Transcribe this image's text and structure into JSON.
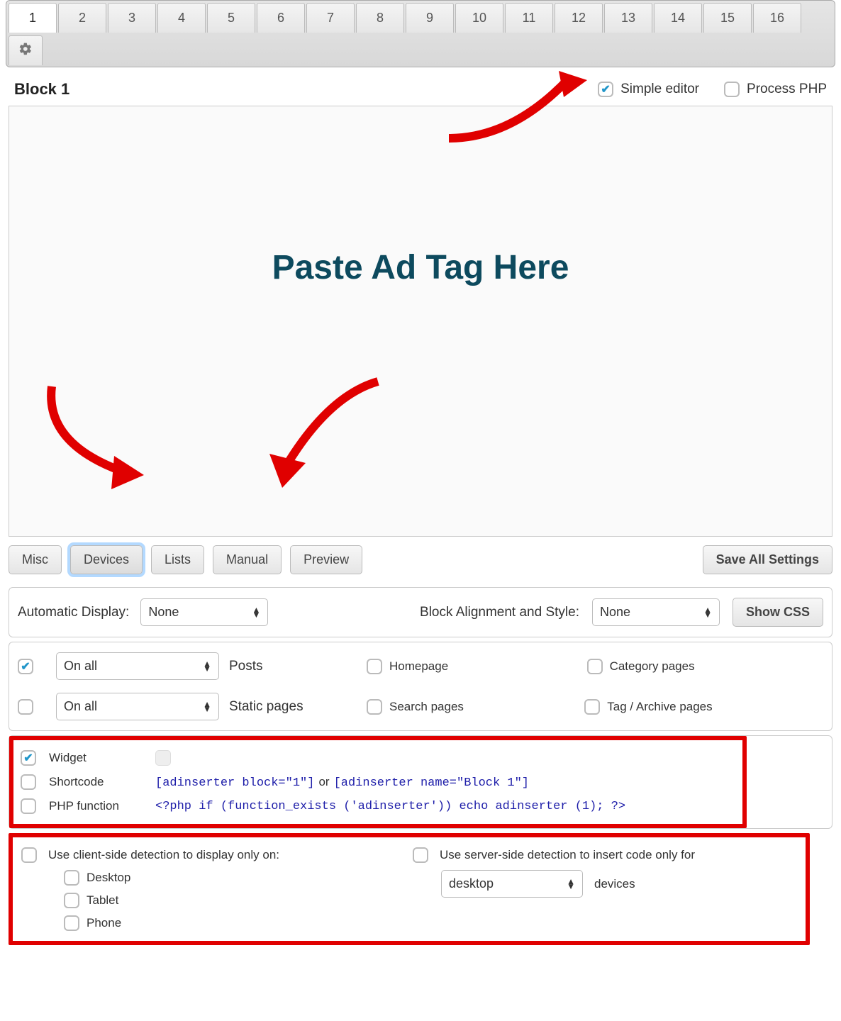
{
  "tabs": {
    "numbers": [
      "1",
      "2",
      "3",
      "4",
      "5",
      "6",
      "7",
      "8",
      "9",
      "10",
      "11",
      "12",
      "13",
      "14",
      "15",
      "16"
    ],
    "active_index": 0
  },
  "header": {
    "block_title": "Block 1",
    "simple_editor": "Simple editor",
    "process_php": "Process PHP"
  },
  "editor": {
    "placeholder": "Paste Ad Tag Here"
  },
  "buttons": {
    "misc": "Misc",
    "devices": "Devices",
    "lists": "Lists",
    "manual": "Manual",
    "preview": "Preview",
    "save_all": "Save All Settings",
    "show_css": "Show CSS"
  },
  "display": {
    "automatic_label": "Automatic Display:",
    "automatic_value": "None",
    "alignment_label": "Block Alignment and Style:",
    "alignment_value": "None"
  },
  "pages": {
    "posts_select": "On all",
    "posts_label": "Posts",
    "static_select": "On all",
    "static_label": "Static pages",
    "homepage": "Homepage",
    "search": "Search pages",
    "category": "Category pages",
    "tag_archive": "Tag / Archive pages"
  },
  "insertion": {
    "widget": "Widget",
    "shortcode": "Shortcode",
    "shortcode_code_1": "[adinserter block=\"1\"]",
    "shortcode_or": "or",
    "shortcode_code_2": "[adinserter name=\"Block 1\"]",
    "php": "PHP function",
    "php_code": "<?php if (function_exists ('adinserter')) echo adinserter (1); ?>"
  },
  "detection": {
    "client_label": "Use client-side detection to display only on:",
    "server_label": "Use server-side detection to insert code only for",
    "desktop": "Desktop",
    "tablet": "Tablet",
    "phone": "Phone",
    "server_select": "desktop",
    "devices_suffix": "devices"
  }
}
